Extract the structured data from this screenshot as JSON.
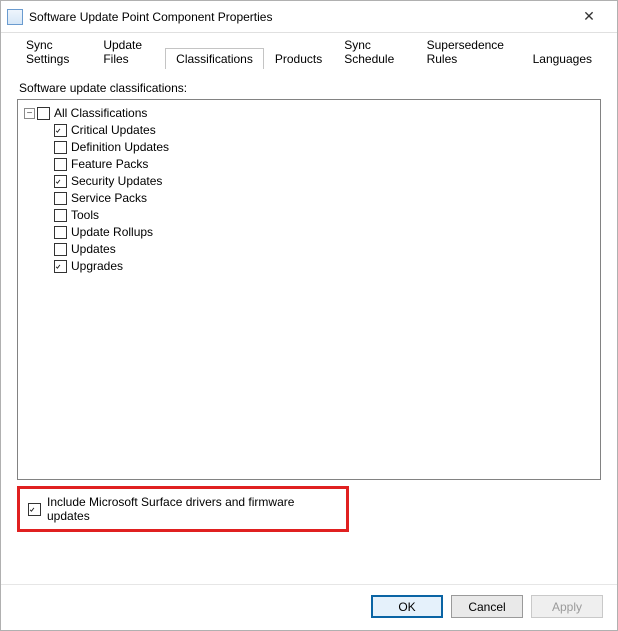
{
  "window": {
    "title": "Software Update Point Component Properties",
    "close_glyph": "✕"
  },
  "tabs": [
    {
      "label": "Sync Settings"
    },
    {
      "label": "Update Files"
    },
    {
      "label": "Classifications"
    },
    {
      "label": "Products"
    },
    {
      "label": "Sync Schedule"
    },
    {
      "label": "Supersedence Rules"
    },
    {
      "label": "Languages"
    }
  ],
  "active_tab": 2,
  "panel": {
    "section_label": "Software update classifications:",
    "root": {
      "label": "All Classifications",
      "checked": false,
      "expander": "−",
      "children": [
        {
          "label": "Critical Updates",
          "checked": true
        },
        {
          "label": "Definition Updates",
          "checked": false
        },
        {
          "label": "Feature Packs",
          "checked": false
        },
        {
          "label": "Security Updates",
          "checked": true
        },
        {
          "label": "Service Packs",
          "checked": false
        },
        {
          "label": "Tools",
          "checked": false
        },
        {
          "label": "Update Rollups",
          "checked": false
        },
        {
          "label": "Updates",
          "checked": false
        },
        {
          "label": "Upgrades",
          "checked": true
        }
      ]
    },
    "include_surface": {
      "label": "Include Microsoft Surface drivers and firmware updates",
      "checked": true
    }
  },
  "buttons": {
    "ok": "OK",
    "cancel": "Cancel",
    "apply": "Apply"
  }
}
